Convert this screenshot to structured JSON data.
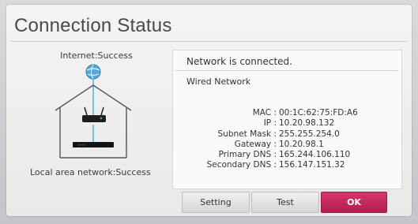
{
  "dialog": {
    "title": "Connection Status"
  },
  "diagram": {
    "internet_label": "Internet:Success",
    "lan_label": "Local area network:Success"
  },
  "info": {
    "status": "Network is connected.",
    "network_type": "Wired Network",
    "rows": [
      {
        "key": "MAC :",
        "value": "00:1C:62:75:FD:A6"
      },
      {
        "key": "IP :",
        "value": "10.20.98.132"
      },
      {
        "key": "Subnet Mask :",
        "value": "255.255.254.0"
      },
      {
        "key": "Gateway :",
        "value": "10.20.98.1"
      },
      {
        "key": "Primary DNS :",
        "value": "165.244.106.110"
      },
      {
        "key": "Secondary DNS :",
        "value": "156.147.151.32"
      }
    ]
  },
  "buttons": {
    "setting": "Setting",
    "test": "Test",
    "ok": "OK"
  },
  "colors": {
    "accent": "#c2285a"
  }
}
